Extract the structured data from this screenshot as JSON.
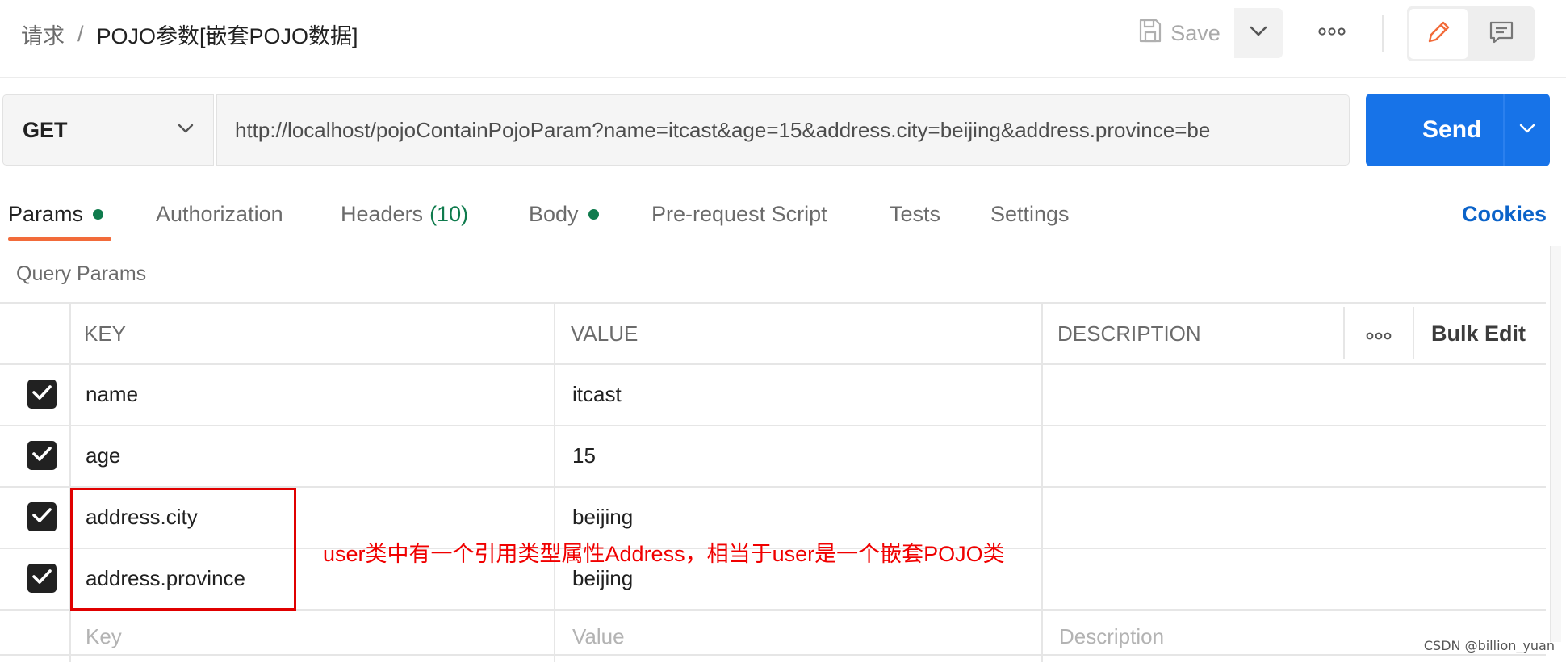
{
  "breadcrumb": {
    "parent": "请求",
    "separator": "/",
    "current": "POJO参数[嵌套POJO数据]"
  },
  "toolbar": {
    "save_label": "Save"
  },
  "request": {
    "method": "GET",
    "url": "http://localhost/pojoContainPojoParam?name=itcast&age=15&address.city=beijing&address.province=be",
    "send_label": "Send"
  },
  "tabs": [
    {
      "label": "Params"
    },
    {
      "label": "Authorization"
    },
    {
      "label": "Headers",
      "count": "(10)"
    },
    {
      "label": "Body"
    },
    {
      "label": "Pre-request Script"
    },
    {
      "label": "Tests"
    },
    {
      "label": "Settings"
    }
  ],
  "cookies_label": "Cookies",
  "query_params_label": "Query Params",
  "table": {
    "headers": {
      "key": "KEY",
      "value": "VALUE",
      "description": "DESCRIPTION",
      "bulk_edit": "Bulk Edit"
    },
    "rows": [
      {
        "key": "name",
        "value": "itcast",
        "checked": true
      },
      {
        "key": "age",
        "value": "15",
        "checked": true
      },
      {
        "key": "address.city",
        "value": "beijing",
        "checked": true
      },
      {
        "key": "address.province",
        "value": "beijing",
        "checked": true
      }
    ],
    "placeholders": {
      "key": "Key",
      "value": "Value",
      "description": "Description"
    }
  },
  "annotation": {
    "text": "user类中有一个引用类型属性Address，相当于user是一个嵌套POJO类",
    "color": "#f00000"
  },
  "watermark": "CSDN @billion_yuan",
  "colors": {
    "send": "#1773e8",
    "tab_indicator": "#f26b3a",
    "status_dot": "#0f7b4d",
    "cookies": "#0b63c9"
  },
  "icons": [
    "save-icon",
    "chevron-down-icon",
    "more-icon",
    "pencil-icon",
    "comment-icon",
    "check-icon"
  ]
}
